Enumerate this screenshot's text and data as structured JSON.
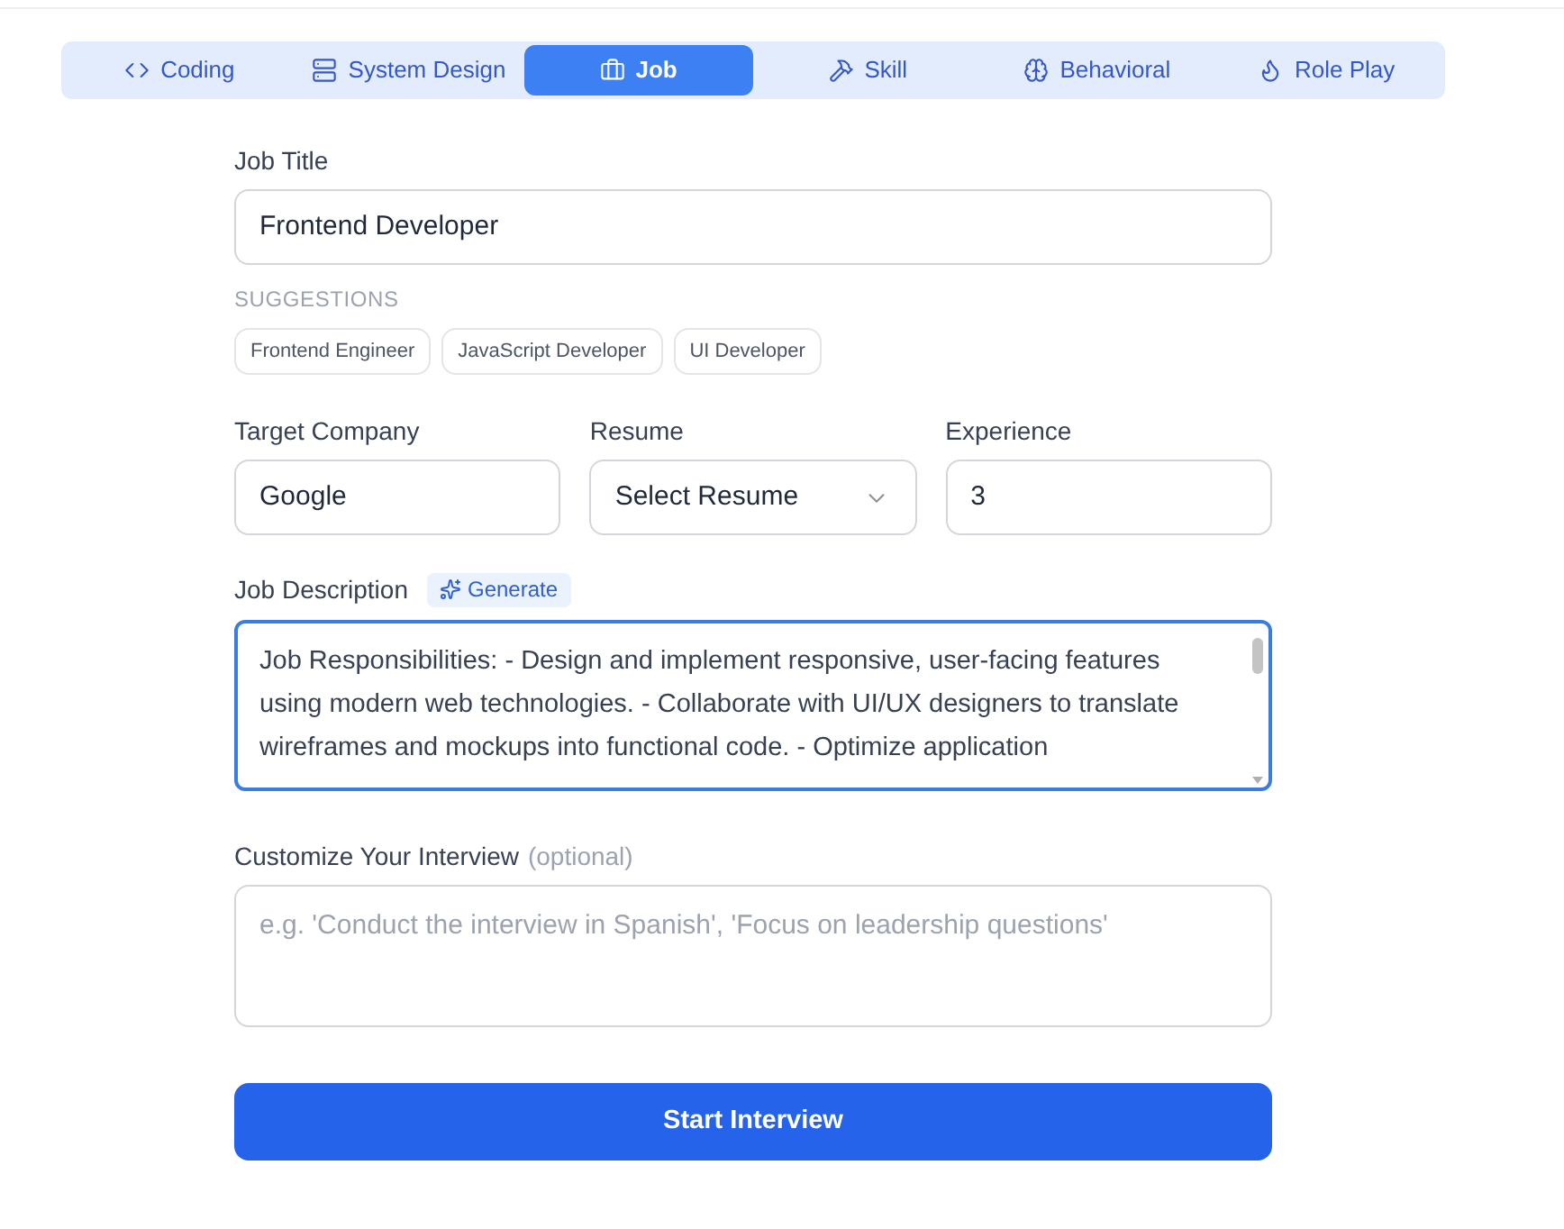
{
  "tabs": [
    {
      "label": "Coding",
      "selected": false
    },
    {
      "label": "System Design",
      "selected": false
    },
    {
      "label": "Job",
      "selected": true
    },
    {
      "label": "Skill",
      "selected": false
    },
    {
      "label": "Behavioral",
      "selected": false
    },
    {
      "label": "Role Play",
      "selected": false
    }
  ],
  "job_title": {
    "label": "Job Title",
    "value": "Frontend Developer"
  },
  "suggestions": {
    "heading": "SUGGESTIONS",
    "items": [
      "Frontend Engineer",
      "JavaScript Developer",
      "UI Developer"
    ]
  },
  "fields": [
    {
      "kind": "input",
      "label": "Target Company",
      "value": "Google"
    },
    {
      "kind": "select",
      "label": "Resume",
      "value": "Select Resume"
    },
    {
      "kind": "input",
      "label": "Experience",
      "value": "3"
    }
  ],
  "job_description": {
    "label": "Job Description",
    "generate_button": "Generate",
    "focused": true,
    "value": "Job Responsibilities: - Design and implement responsive, user-facing features using modern web technologies. - Collaborate with UI/UX designers to translate wireframes and mockups into functional code. - Optimize application"
  },
  "customize": {
    "label": "Customize Your Interview",
    "note": "(optional)",
    "placeholder": "e.g. 'Conduct the interview in Spanish', 'Focus on leadership questions'"
  },
  "submit_button": "Start Interview"
}
